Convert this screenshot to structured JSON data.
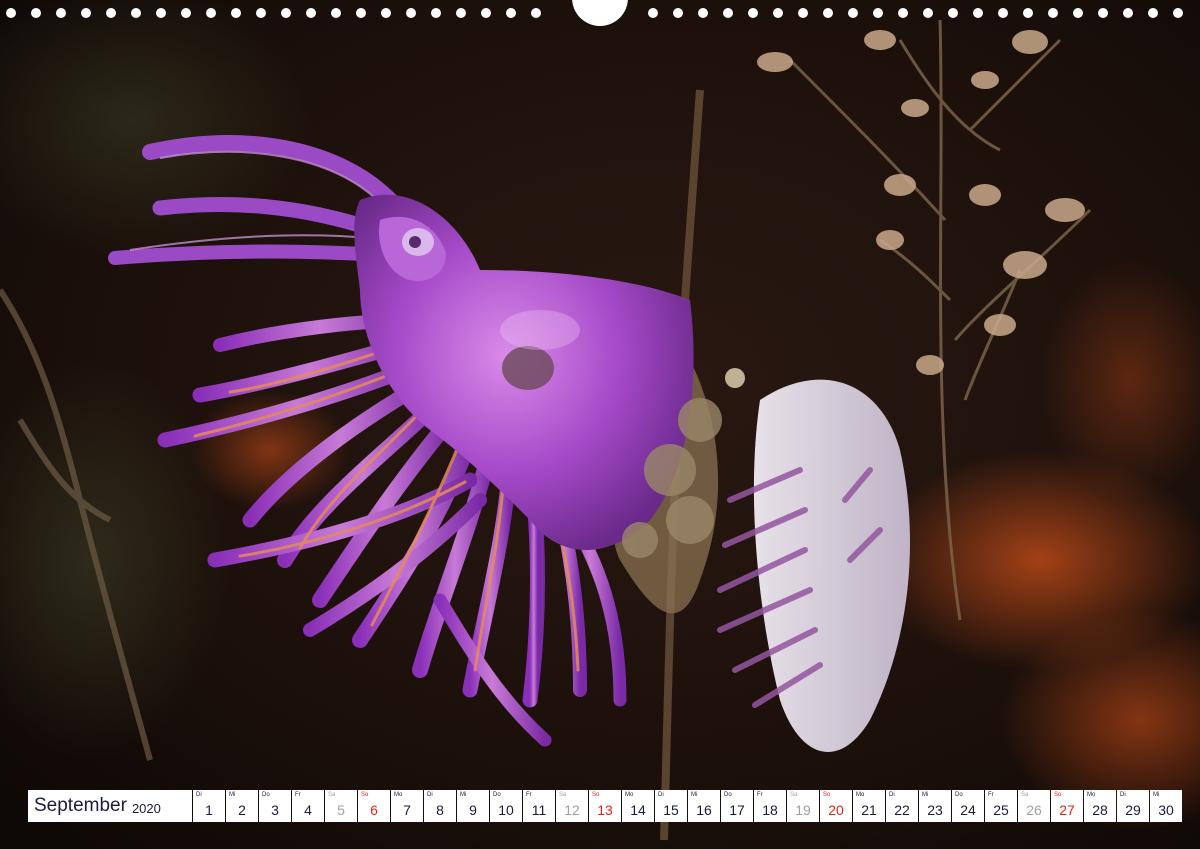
{
  "calendar": {
    "month": "September",
    "year": "2020",
    "days": [
      {
        "dow": "Di",
        "num": "1",
        "type": "wd"
      },
      {
        "dow": "Mi",
        "num": "2",
        "type": "wd"
      },
      {
        "dow": "Do",
        "num": "3",
        "type": "wd"
      },
      {
        "dow": "Fr",
        "num": "4",
        "type": "wd"
      },
      {
        "dow": "Sa",
        "num": "5",
        "type": "sa"
      },
      {
        "dow": "So",
        "num": "6",
        "type": "so"
      },
      {
        "dow": "Mo",
        "num": "7",
        "type": "wd"
      },
      {
        "dow": "Di",
        "num": "8",
        "type": "wd"
      },
      {
        "dow": "Mi",
        "num": "9",
        "type": "wd"
      },
      {
        "dow": "Do",
        "num": "10",
        "type": "wd"
      },
      {
        "dow": "Fr",
        "num": "11",
        "type": "wd"
      },
      {
        "dow": "Sa",
        "num": "12",
        "type": "sa"
      },
      {
        "dow": "So",
        "num": "13",
        "type": "so"
      },
      {
        "dow": "Mo",
        "num": "14",
        "type": "wd"
      },
      {
        "dow": "Di",
        "num": "15",
        "type": "wd"
      },
      {
        "dow": "Mi",
        "num": "16",
        "type": "wd"
      },
      {
        "dow": "Do",
        "num": "17",
        "type": "wd"
      },
      {
        "dow": "Fr",
        "num": "18",
        "type": "wd"
      },
      {
        "dow": "Sa",
        "num": "19",
        "type": "sa"
      },
      {
        "dow": "So",
        "num": "20",
        "type": "so"
      },
      {
        "dow": "Mo",
        "num": "21",
        "type": "wd"
      },
      {
        "dow": "Di",
        "num": "22",
        "type": "wd"
      },
      {
        "dow": "Mi",
        "num": "23",
        "type": "wd"
      },
      {
        "dow": "Do",
        "num": "24",
        "type": "wd"
      },
      {
        "dow": "Fr",
        "num": "25",
        "type": "wd"
      },
      {
        "dow": "Sa",
        "num": "26",
        "type": "sa"
      },
      {
        "dow": "So",
        "num": "27",
        "type": "so"
      },
      {
        "dow": "Mo",
        "num": "28",
        "type": "wd"
      },
      {
        "dow": "Di",
        "num": "29",
        "type": "wd"
      },
      {
        "dow": "Mi",
        "num": "30",
        "type": "wd"
      }
    ]
  },
  "colors": {
    "weekday_text": "#1e1a3a",
    "saturday_text": "#a0a0a0",
    "sunday_text": "#e2231a",
    "background": "#1a0f0a"
  }
}
